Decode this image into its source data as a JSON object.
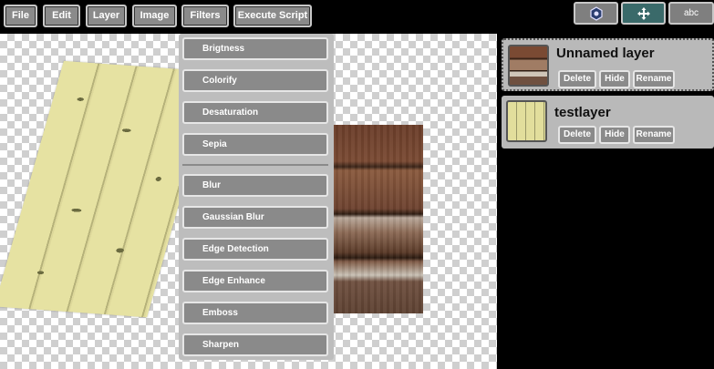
{
  "menu": {
    "file": "File",
    "edit": "Edit",
    "layer": "Layer",
    "image": "Image",
    "filters": "Filters",
    "execute_script": "Execute Script"
  },
  "tools": {
    "text_tool_label": "abc",
    "icons": [
      "hexagon-icon",
      "move-arrows-icon"
    ],
    "colors": {
      "inactive": "#7f7f7f",
      "active": "#3a6a6a"
    }
  },
  "filters_menu": {
    "items": [
      "Brigtness",
      "Colorify",
      "Desaturation",
      "Sepia",
      "Blur",
      "Gaussian Blur",
      "Edge Detection",
      "Edge Enhance",
      "Emboss",
      "Sharpen"
    ]
  },
  "layers": [
    {
      "name": "Unnamed layer",
      "selected": true,
      "delete": "Delete",
      "hide": "Hide",
      "rename": "Rename"
    },
    {
      "name": "testlayer",
      "selected": false,
      "delete": "Delete",
      "hide": "Hide",
      "rename": "Rename"
    }
  ]
}
